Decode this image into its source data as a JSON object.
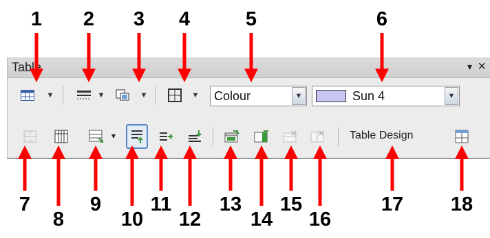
{
  "toolbar": {
    "title": "Table",
    "menu_glyph": "▾",
    "close_glyph": "×",
    "colour_combo": {
      "value": "Colour"
    },
    "border_color_combo": {
      "value": "Sun 4",
      "swatch_color": "#c9c6f5"
    },
    "table_design_label": "Table Design"
  },
  "callouts": {
    "top": [
      "1",
      "2",
      "3",
      "4",
      "5",
      "6"
    ],
    "bottom": [
      "7",
      "8",
      "9",
      "10",
      "11",
      "12",
      "13",
      "14",
      "15",
      "16",
      "17",
      "18"
    ]
  },
  "colors": {
    "arrow": "#ff0000",
    "active_outline": "#5b86c5"
  }
}
